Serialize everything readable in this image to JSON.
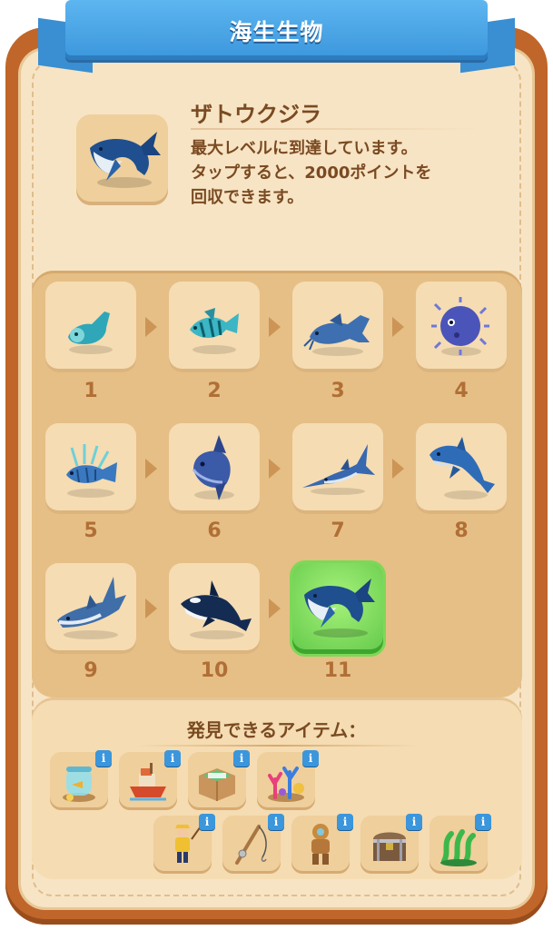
{
  "header": {
    "title": "海生生物"
  },
  "hero": {
    "icon": "humpback-whale-icon",
    "name": "ザトウクジラ",
    "desc_lines": [
      "最大レベルに到達しています。",
      "タップすると、2000ポイントを",
      "回収できます。"
    ]
  },
  "levels": [
    {
      "label": "1",
      "icon": "tadpole-fish-icon"
    },
    {
      "label": "2",
      "icon": "tropical-fish-icon"
    },
    {
      "label": "3",
      "icon": "catfish-icon"
    },
    {
      "label": "4",
      "icon": "pufferfish-icon"
    },
    {
      "label": "5",
      "icon": "lionfish-icon"
    },
    {
      "label": "6",
      "icon": "sunfish-icon"
    },
    {
      "label": "7",
      "icon": "swordfish-icon"
    },
    {
      "label": "8",
      "icon": "dolphin-icon"
    },
    {
      "label": "9",
      "icon": "shark-icon"
    },
    {
      "label": "10",
      "icon": "orca-icon"
    },
    {
      "label": "11",
      "icon": "humpback-whale-icon",
      "selected": true
    }
  ],
  "items": {
    "title": "発見できるアイテム：",
    "info_label": "i",
    "list": [
      {
        "icon": "fish-bowl-icon"
      },
      {
        "icon": "fishing-boat-icon"
      },
      {
        "icon": "open-box-icon"
      },
      {
        "icon": "coral-reef-icon"
      },
      {
        "icon": "fisherman-icon"
      },
      {
        "icon": "fishing-rod-icon"
      },
      {
        "icon": "diver-suit-icon"
      },
      {
        "icon": "treasure-chest-icon"
      },
      {
        "icon": "seaweed-icon"
      }
    ]
  },
  "colors": {
    "ribbon": "#3b96dc",
    "frame": "#c0662a",
    "panel": "#e6bf86",
    "selected": "#62c94a",
    "text": "#7a4a22",
    "number": "#b06f36"
  }
}
